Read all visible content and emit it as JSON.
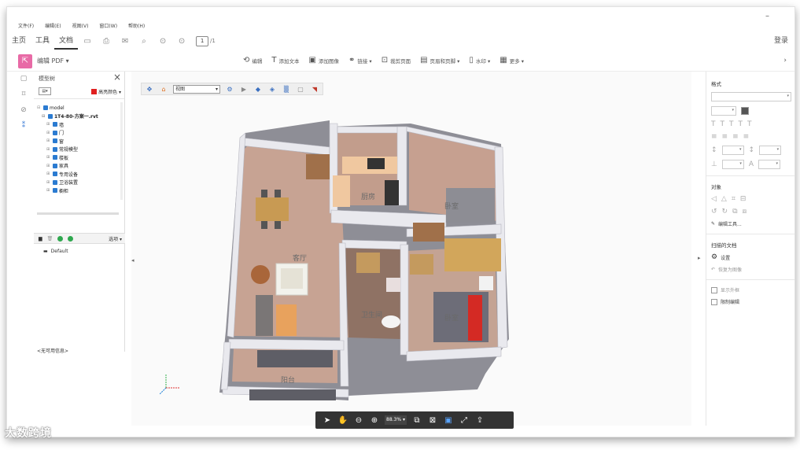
{
  "menu": [
    "文件(F)",
    "编辑(E)",
    "视图(V)",
    "窗口(W)",
    "帮助(H)"
  ],
  "tabs": [
    "主页",
    "工具",
    "文档"
  ],
  "active_tab": "文档",
  "page": {
    "current": "1",
    "total": "/1"
  },
  "login_label": "登录",
  "edit_pdf_label": "编辑 PDF ▾",
  "edit_tools": [
    {
      "icon": "edit-icon",
      "label": "编辑"
    },
    {
      "icon": "text-icon",
      "label": "添加文本"
    },
    {
      "icon": "image-icon",
      "label": "添加图像"
    },
    {
      "icon": "link-icon",
      "label": "链接 ▾"
    },
    {
      "icon": "crop-icon",
      "label": "裁剪页面"
    },
    {
      "icon": "header-icon",
      "label": "页眉和页脚 ▾"
    },
    {
      "icon": "watermark-icon",
      "label": "水印 ▾"
    },
    {
      "icon": "more-icon",
      "label": "更多 ▾"
    }
  ],
  "model_tree": {
    "title": "模型树",
    "highlight_label": "高亮颜色 ▾",
    "highlight_color": "#e02020",
    "items": [
      {
        "label": "model",
        "level": 0,
        "bold": false
      },
      {
        "label": "1T4-80-方案一.rvt",
        "level": 1,
        "bold": true
      },
      {
        "label": "墙",
        "level": 2,
        "bold": false
      },
      {
        "label": "门",
        "level": 2,
        "bold": false
      },
      {
        "label": "窗",
        "level": 2,
        "bold": false
      },
      {
        "label": "常规模型",
        "level": 2,
        "bold": false
      },
      {
        "label": "楼板",
        "level": 2,
        "bold": false
      },
      {
        "label": "家具",
        "level": 2,
        "bold": false
      },
      {
        "label": "专用设备",
        "level": 2,
        "bold": false
      },
      {
        "label": "卫浴装置",
        "level": 2,
        "bold": false
      },
      {
        "label": "橱柜",
        "level": 2,
        "bold": false
      }
    ],
    "options_label": "选项 ▾",
    "default_label": "Default",
    "no_props": "<无可用信息>"
  },
  "viewer": {
    "view_select": "视图",
    "rooms": [
      "客厅",
      "厨房",
      "卧室",
      "卫生间",
      "卧室",
      "阳台"
    ],
    "zoom": "88.3% ▾"
  },
  "properties": {
    "format": "格式",
    "object": "对象",
    "edit_tool": "编辑工具...",
    "scanned_doc": "扫描的文档",
    "settings": "设置",
    "restore_image": "恢复为图像",
    "show_border": "显示外框",
    "restrict_edit": "限制编辑"
  },
  "watermark_text": "大数跨境"
}
